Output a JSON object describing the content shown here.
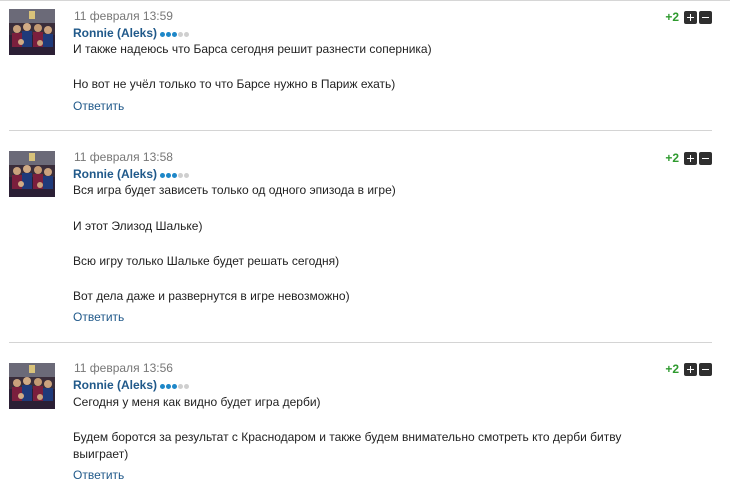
{
  "comments": [
    {
      "date": "11 февраля 13:59",
      "author": "Ronnie (Aleks)",
      "rating_dots": 5,
      "rating_level": 3,
      "score": "+2",
      "paragraphs": [
        "И также надеюсь что Барса сегодня решит разнести соперника)",
        "Но вот не учёл только то что Барсе нужно в Париж ехать)"
      ],
      "reply_label": "Ответить"
    },
    {
      "date": "11 февраля 13:58",
      "author": "Ronnie (Aleks)",
      "rating_dots": 5,
      "rating_level": 3,
      "score": "+2",
      "paragraphs": [
        "Вся игра будет зависеть только од одного эпизода в игре)",
        "И этот Элизод Шальке)",
        "Всю игру только Шальке будет решать сегодня)",
        "Вот дела даже и развернутся в игре невозможно)"
      ],
      "reply_label": "Ответить"
    },
    {
      "date": "11 февраля 13:56",
      "author": "Ronnie (Aleks)",
      "rating_dots": 5,
      "rating_level": 3,
      "score": "+2",
      "paragraphs": [
        "Сегодня у меня как видно будет игра дерби)",
        "Будем боротся за результат с Краснодаром и также будем внимательно смотреть кто дерби битву выиграет)"
      ],
      "reply_label": "Ответить"
    }
  ],
  "icons": {
    "vote_up": "plus-icon",
    "vote_down": "minus-icon"
  },
  "colors": {
    "author": "#20598a",
    "score": "#2e9a2e",
    "rating_dot_on": "#1e87c8",
    "rating_dot_off": "#cfcfcf",
    "vote_button": "#2f2f2f"
  }
}
